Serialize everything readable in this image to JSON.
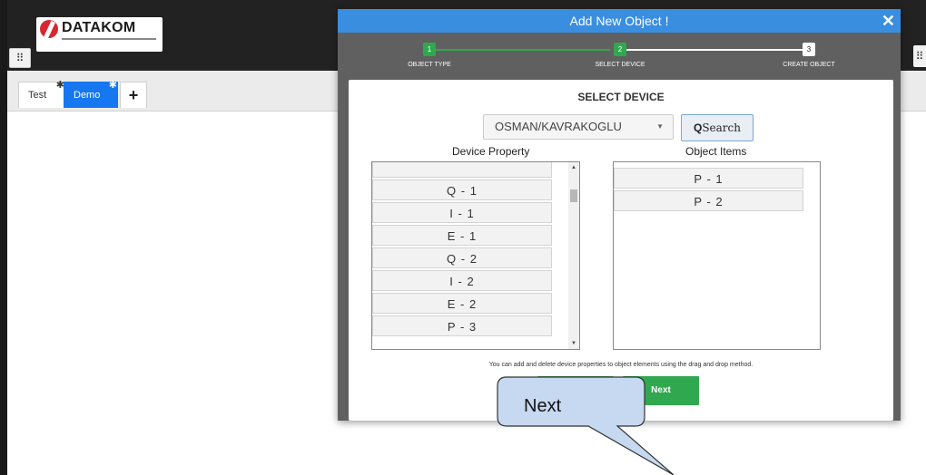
{
  "app": {
    "logo_text": "DATAKOM",
    "grid_icon": "grid-icon"
  },
  "tabs": [
    {
      "label": "Test",
      "active": false
    },
    {
      "label": "Demo",
      "active": true
    },
    {
      "label": "+"
    }
  ],
  "modal": {
    "title": "Add New Object !",
    "close": "✕",
    "steps": [
      {
        "number": "1",
        "label": "OBJECT TYPE",
        "state": "done"
      },
      {
        "number": "2",
        "label": "SELECT DEVICE",
        "state": "current"
      },
      {
        "number": "3",
        "label": "CREATE OBJECT",
        "state": "pending"
      }
    ],
    "section_title": "SELECT DEVICE",
    "device_select": {
      "value": "OSMAN/KAVRAKOGLU"
    },
    "search_button": {
      "icon_text": "Q",
      "label": "Search"
    },
    "device_property": {
      "title": "Device Property",
      "items": [
        "Q - 1",
        "I - 1",
        "E - 1",
        "Q - 2",
        "I - 2",
        "E - 2",
        "P - 3"
      ]
    },
    "object_items": {
      "title": "Object Items",
      "items": [
        "P - 1",
        "P - 2"
      ]
    },
    "hint": "You can add and delete device properties to object elements using the drag and drop method.",
    "next_button": "Next"
  },
  "callout": {
    "text": "Next"
  },
  "colors": {
    "header_blue": "#3a8ee0",
    "step_green": "#2fa84f",
    "tab_active": "#1677f0",
    "callout_fill": "#c6d9f1"
  }
}
